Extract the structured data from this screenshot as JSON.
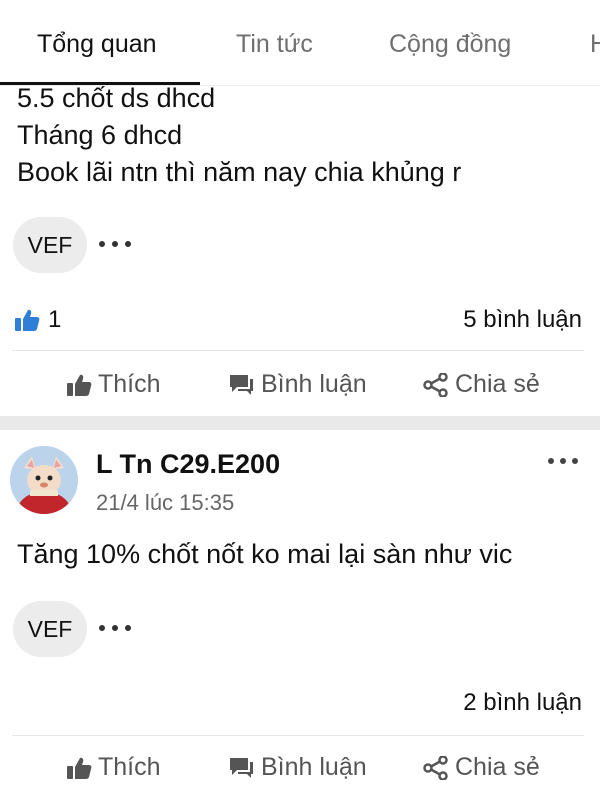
{
  "tabs": [
    {
      "label": "Tổng quan",
      "active": true
    },
    {
      "label": "Tin tức",
      "active": false
    },
    {
      "label": "Cộng đồng",
      "active": false
    },
    {
      "label": "H",
      "active": false
    }
  ],
  "posts": [
    {
      "text_lines": [
        "5.5 chốt ds dhcd",
        "Tháng 6 dhcd",
        "Book lãi ntn thì năm nay chia khủng r"
      ],
      "tag": "VEF",
      "likes": "1",
      "comments": "5 bình luận",
      "actions": {
        "like": "Thích",
        "comment": "Bình luận",
        "share": "Chia sẻ"
      }
    },
    {
      "author": "L Tn C29.E200",
      "timestamp": "21/4 lúc 15:35",
      "text_lines": [
        "Tăng 10% chốt nốt ko mai lại sàn như vic"
      ],
      "tag": "VEF",
      "comments": "2 bình luận",
      "actions": {
        "like": "Thích",
        "comment": "Bình luận",
        "share": "Chia sẻ"
      }
    }
  ],
  "colors": {
    "like_icon": "#2f7fd8",
    "divider": "#e6e6e6",
    "chip_bg": "#ececec"
  }
}
